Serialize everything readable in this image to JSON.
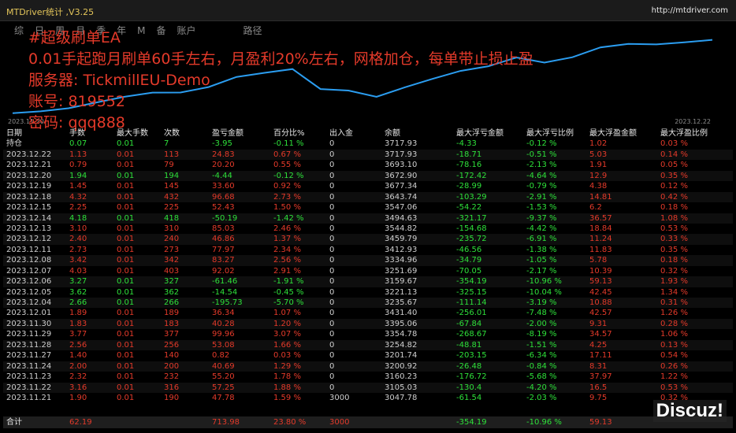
{
  "app": {
    "title": "MTDriver统计 ,V3.25",
    "url": "http://mtdriver.com"
  },
  "menu": [
    "综",
    "日",
    "周",
    "月",
    "季",
    "年",
    "M",
    "备",
    "账户",
    "路径"
  ],
  "chart": {
    "date_start": "2023.11.20",
    "date_end": "2023.12.22",
    "line_color": "#2b9df0",
    "equity": [
      3000,
      3018,
      3047.78,
      3105.03,
      3160.23,
      3200.92,
      3201.74,
      3254.82,
      3354.78,
      3395.06,
      3431.4,
      3235.67,
      3221.13,
      3159.67,
      3251.69,
      3334.96,
      3412.93,
      3459.79,
      3544.82,
      3494.63,
      3547.06,
      3643.74,
      3677.34,
      3672.9,
      3693.1,
      3717.93
    ]
  },
  "overlay": {
    "line1": "#超级刷单EA",
    "line2": "0.01手起跑月刷单60手左右，月盈利20%左右，网格加仓，每单带止损止盈",
    "line3": "服务器: TickmillEU-Demo",
    "line4": "账号: 819552",
    "line5": "密码: qqq888"
  },
  "table": {
    "headers": [
      "日期",
      "手数",
      "最大手数",
      "次数",
      "盈亏金额",
      "百分比%",
      "出入金",
      "余额",
      "最大浮亏金额",
      "最大浮亏比例",
      "最大浮盈金额",
      "最大浮盈比例"
    ],
    "rows": [
      {
        "date": "持仓",
        "lots": "0.07",
        "max_lots": "0.01",
        "count": "7",
        "pnl": "-3.95",
        "pct": "-0.11 %",
        "io": "0",
        "balance": "3717.93",
        "max_dd": "-4.33",
        "max_dd_pct": "-0.12 %",
        "max_fp": "1.02",
        "max_fp_pct": "0.03 %",
        "tone": "green"
      },
      {
        "date": "2023.12.22",
        "lots": "1.13",
        "max_lots": "0.01",
        "count": "113",
        "pnl": "24.83",
        "pct": "0.67 %",
        "io": "0",
        "balance": "3717.93",
        "max_dd": "-18.71",
        "max_dd_pct": "-0.51 %",
        "max_fp": "5.03",
        "max_fp_pct": "0.14 %",
        "tone": "red"
      },
      {
        "date": "2023.12.21",
        "lots": "0.79",
        "max_lots": "0.01",
        "count": "79",
        "pnl": "20.20",
        "pct": "0.55 %",
        "io": "0",
        "balance": "3693.10",
        "max_dd": "-78.16",
        "max_dd_pct": "-2.13 %",
        "max_fp": "1.91",
        "max_fp_pct": "0.05 %",
        "tone": "red"
      },
      {
        "date": "2023.12.20",
        "lots": "1.94",
        "max_lots": "0.01",
        "count": "194",
        "pnl": "-4.44",
        "pct": "-0.12 %",
        "io": "0",
        "balance": "3672.90",
        "max_dd": "-172.42",
        "max_dd_pct": "-4.64 %",
        "max_fp": "12.9",
        "max_fp_pct": "0.35 %",
        "tone": "green"
      },
      {
        "date": "2023.12.19",
        "lots": "1.45",
        "max_lots": "0.01",
        "count": "145",
        "pnl": "33.60",
        "pct": "0.92 %",
        "io": "0",
        "balance": "3677.34",
        "max_dd": "-28.99",
        "max_dd_pct": "-0.79 %",
        "max_fp": "4.38",
        "max_fp_pct": "0.12 %",
        "tone": "red"
      },
      {
        "date": "2023.12.18",
        "lots": "4.32",
        "max_lots": "0.01",
        "count": "432",
        "pnl": "96.68",
        "pct": "2.73 %",
        "io": "0",
        "balance": "3643.74",
        "max_dd": "-103.29",
        "max_dd_pct": "-2.91 %",
        "max_fp": "14.81",
        "max_fp_pct": "0.42 %",
        "tone": "red"
      },
      {
        "date": "2023.12.15",
        "lots": "2.25",
        "max_lots": "0.01",
        "count": "225",
        "pnl": "52.43",
        "pct": "1.50 %",
        "io": "0",
        "balance": "3547.06",
        "max_dd": "-54.22",
        "max_dd_pct": "-1.53 %",
        "max_fp": "6.2",
        "max_fp_pct": "0.18 %",
        "tone": "red"
      },
      {
        "date": "2023.12.14",
        "lots": "4.18",
        "max_lots": "0.01",
        "count": "418",
        "pnl": "-50.19",
        "pct": "-1.42 %",
        "io": "0",
        "balance": "3494.63",
        "max_dd": "-321.17",
        "max_dd_pct": "-9.37 %",
        "max_fp": "36.57",
        "max_fp_pct": "1.08 %",
        "tone": "green"
      },
      {
        "date": "2023.12.13",
        "lots": "3.10",
        "max_lots": "0.01",
        "count": "310",
        "pnl": "85.03",
        "pct": "2.46 %",
        "io": "0",
        "balance": "3544.82",
        "max_dd": "-154.68",
        "max_dd_pct": "-4.42 %",
        "max_fp": "18.84",
        "max_fp_pct": "0.53 %",
        "tone": "red"
      },
      {
        "date": "2023.12.12",
        "lots": "2.40",
        "max_lots": "0.01",
        "count": "240",
        "pnl": "46.86",
        "pct": "1.37 %",
        "io": "0",
        "balance": "3459.79",
        "max_dd": "-235.72",
        "max_dd_pct": "-6.91 %",
        "max_fp": "11.24",
        "max_fp_pct": "0.33 %",
        "tone": "red"
      },
      {
        "date": "2023.12.11",
        "lots": "2.73",
        "max_lots": "0.01",
        "count": "273",
        "pnl": "77.97",
        "pct": "2.34 %",
        "io": "0",
        "balance": "3412.93",
        "max_dd": "-46.56",
        "max_dd_pct": "-1.38 %",
        "max_fp": "11.83",
        "max_fp_pct": "0.35 %",
        "tone": "red"
      },
      {
        "date": "2023.12.08",
        "lots": "3.42",
        "max_lots": "0.01",
        "count": "342",
        "pnl": "83.27",
        "pct": "2.56 %",
        "io": "0",
        "balance": "3334.96",
        "max_dd": "-34.79",
        "max_dd_pct": "-1.05 %",
        "max_fp": "5.78",
        "max_fp_pct": "0.18 %",
        "tone": "red"
      },
      {
        "date": "2023.12.07",
        "lots": "4.03",
        "max_lots": "0.01",
        "count": "403",
        "pnl": "92.02",
        "pct": "2.91 %",
        "io": "0",
        "balance": "3251.69",
        "max_dd": "-70.05",
        "max_dd_pct": "-2.17 %",
        "max_fp": "10.39",
        "max_fp_pct": "0.32 %",
        "tone": "red"
      },
      {
        "date": "2023.12.06",
        "lots": "3.27",
        "max_lots": "0.01",
        "count": "327",
        "pnl": "-61.46",
        "pct": "-1.91 %",
        "io": "0",
        "balance": "3159.67",
        "max_dd": "-354.19",
        "max_dd_pct": "-10.96 %",
        "max_fp": "59.13",
        "max_fp_pct": "1.93 %",
        "tone": "green"
      },
      {
        "date": "2023.12.05",
        "lots": "3.62",
        "max_lots": "0.01",
        "count": "362",
        "pnl": "-14.54",
        "pct": "-0.45 %",
        "io": "0",
        "balance": "3221.13",
        "max_dd": "-325.15",
        "max_dd_pct": "-10.04 %",
        "max_fp": "42.45",
        "max_fp_pct": "1.34 %",
        "tone": "green"
      },
      {
        "date": "2023.12.04",
        "lots": "2.66",
        "max_lots": "0.01",
        "count": "266",
        "pnl": "-195.73",
        "pct": "-5.70 %",
        "io": "0",
        "balance": "3235.67",
        "max_dd": "-111.14",
        "max_dd_pct": "-3.19 %",
        "max_fp": "10.88",
        "max_fp_pct": "0.31 %",
        "tone": "green"
      },
      {
        "date": "2023.12.01",
        "lots": "1.89",
        "max_lots": "0.01",
        "count": "189",
        "pnl": "36.34",
        "pct": "1.07 %",
        "io": "0",
        "balance": "3431.40",
        "max_dd": "-256.01",
        "max_dd_pct": "-7.48 %",
        "max_fp": "42.57",
        "max_fp_pct": "1.26 %",
        "tone": "red"
      },
      {
        "date": "2023.11.30",
        "lots": "1.83",
        "max_lots": "0.01",
        "count": "183",
        "pnl": "40.28",
        "pct": "1.20 %",
        "io": "0",
        "balance": "3395.06",
        "max_dd": "-67.84",
        "max_dd_pct": "-2.00 %",
        "max_fp": "9.31",
        "max_fp_pct": "0.28 %",
        "tone": "red"
      },
      {
        "date": "2023.11.29",
        "lots": "3.77",
        "max_lots": "0.01",
        "count": "377",
        "pnl": "99.96",
        "pct": "3.07 %",
        "io": "0",
        "balance": "3354.78",
        "max_dd": "-268.67",
        "max_dd_pct": "-8.19 %",
        "max_fp": "34.57",
        "max_fp_pct": "1.06 %",
        "tone": "red"
      },
      {
        "date": "2023.11.28",
        "lots": "2.56",
        "max_lots": "0.01",
        "count": "256",
        "pnl": "53.08",
        "pct": "1.66 %",
        "io": "0",
        "balance": "3254.82",
        "max_dd": "-48.81",
        "max_dd_pct": "-1.51 %",
        "max_fp": "4.25",
        "max_fp_pct": "0.13 %",
        "tone": "red"
      },
      {
        "date": "2023.11.27",
        "lots": "1.40",
        "max_lots": "0.01",
        "count": "140",
        "pnl": "0.82",
        "pct": "0.03 %",
        "io": "0",
        "balance": "3201.74",
        "max_dd": "-203.15",
        "max_dd_pct": "-6.34 %",
        "max_fp": "17.11",
        "max_fp_pct": "0.54 %",
        "tone": "red"
      },
      {
        "date": "2023.11.24",
        "lots": "2.00",
        "max_lots": "0.01",
        "count": "200",
        "pnl": "40.69",
        "pct": "1.29 %",
        "io": "0",
        "balance": "3200.92",
        "max_dd": "-26.48",
        "max_dd_pct": "-0.84 %",
        "max_fp": "8.31",
        "max_fp_pct": "0.26 %",
        "tone": "red"
      },
      {
        "date": "2023.11.23",
        "lots": "2.32",
        "max_lots": "0.01",
        "count": "232",
        "pnl": "55.20",
        "pct": "1.78 %",
        "io": "0",
        "balance": "3160.23",
        "max_dd": "-176.72",
        "max_dd_pct": "-5.68 %",
        "max_fp": "37.97",
        "max_fp_pct": "1.22 %",
        "tone": "red"
      },
      {
        "date": "2023.11.22",
        "lots": "3.16",
        "max_lots": "0.01",
        "count": "316",
        "pnl": "57.25",
        "pct": "1.88 %",
        "io": "0",
        "balance": "3105.03",
        "max_dd": "-130.4",
        "max_dd_pct": "-4.20 %",
        "max_fp": "16.5",
        "max_fp_pct": "0.53 %",
        "tone": "red"
      },
      {
        "date": "2023.11.21",
        "lots": "1.90",
        "max_lots": "0.01",
        "count": "190",
        "pnl": "47.78",
        "pct": "1.59 %",
        "io": "3000",
        "balance": "3047.78",
        "max_dd": "-61.54",
        "max_dd_pct": "-2.03 %",
        "max_fp": "9.75",
        "max_fp_pct": "0.32 %",
        "tone": "red"
      }
    ],
    "total": {
      "label": "合计",
      "lots": "62.19",
      "pnl": "713.98",
      "pct": "23.80 %",
      "io": "3000",
      "max_dd": "-354.19",
      "max_dd_pct": "-10.96 %",
      "max_fp": "59.13"
    }
  },
  "watermark": "Discuz!"
}
